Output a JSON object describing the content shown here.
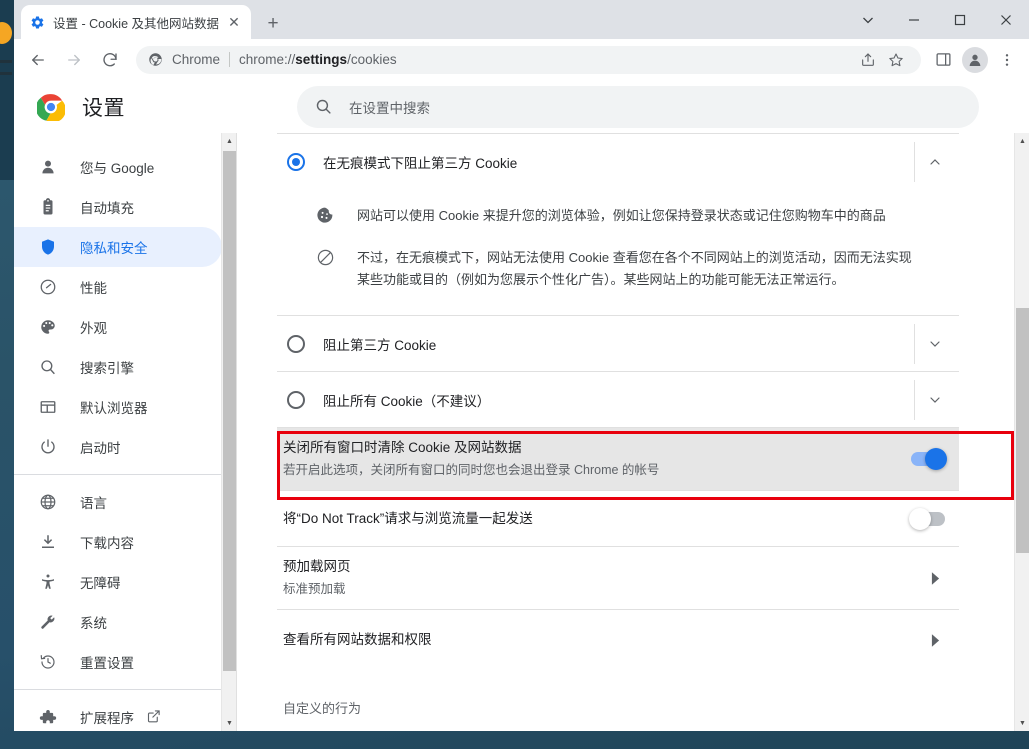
{
  "window": {
    "controls": {
      "tab_search_label": "tab-search",
      "minimize_label": "—",
      "maximize_label": "▢",
      "close_label": "✕"
    }
  },
  "tab": {
    "title": "设置 - Cookie 及其他网站数据",
    "close_label": "✕",
    "favicon_name": "settings-gear-icon",
    "newtab_label": "+"
  },
  "toolbar": {
    "back_label": "←",
    "forward_label": "→",
    "reload_label": "⟳",
    "omnibox": {
      "scheme_label": "Chrome",
      "url_prefix": "chrome://",
      "url_bold": "settings",
      "url_suffix": "/cookies"
    }
  },
  "settings_header": {
    "title": "设置",
    "search_placeholder": "在设置中搜索"
  },
  "sidebar": {
    "groups": [
      {
        "items": [
          {
            "label": "您与 Google",
            "icon": "person-icon",
            "selected": false
          },
          {
            "label": "自动填充",
            "icon": "clipboard-icon",
            "selected": false
          },
          {
            "label": "隐私和安全",
            "icon": "shield-icon",
            "selected": true
          },
          {
            "label": "性能",
            "icon": "speedometer-icon",
            "selected": false
          },
          {
            "label": "外观",
            "icon": "palette-icon",
            "selected": false
          },
          {
            "label": "搜索引擎",
            "icon": "search-icon",
            "selected": false
          },
          {
            "label": "默认浏览器",
            "icon": "browser-window-icon",
            "selected": false
          },
          {
            "label": "启动时",
            "icon": "power-icon",
            "selected": false
          }
        ]
      },
      {
        "items": [
          {
            "label": "语言",
            "icon": "globe-icon",
            "selected": false
          },
          {
            "label": "下载内容",
            "icon": "download-icon",
            "selected": false
          },
          {
            "label": "无障碍",
            "icon": "accessibility-icon",
            "selected": false
          },
          {
            "label": "系统",
            "icon": "wrench-icon",
            "selected": false
          },
          {
            "label": "重置设置",
            "icon": "history-restore-icon",
            "selected": false
          }
        ]
      },
      {
        "items": [
          {
            "label": "扩展程序",
            "icon": "puzzle-icon",
            "selected": false,
            "external": true
          }
        ]
      }
    ]
  },
  "main": {
    "expanded_option": {
      "label": "在无痕模式下阻止第三方 Cookie",
      "checked": true,
      "chevron": "up",
      "bullets": [
        {
          "icon": "cookie-icon",
          "text": "网站可以使用 Cookie 来提升您的浏览体验，例如让您保持登录状态或记住您购物车中的商品"
        },
        {
          "icon": "blocked-icon",
          "text": "不过，在无痕模式下，网站无法使用 Cookie 查看您在各个不同网站上的浏览活动，因而无法实现某些功能或目的（例如为您展示个性化广告）。某些网站上的功能可能无法正常运行。"
        }
      ]
    },
    "options": [
      {
        "label": "阻止第三方 Cookie",
        "checked": false,
        "chevron": "down"
      },
      {
        "label": "阻止所有 Cookie（不建议）",
        "checked": false,
        "chevron": "down"
      }
    ],
    "clear_on_close": {
      "title": "关闭所有窗口时清除 Cookie 及网站数据",
      "subtitle": "若开启此选项，关闭所有窗口的同时您也会退出登录 Chrome 的帐号",
      "toggle_state": "on",
      "highlighted": true,
      "highlight_color": "#e8000d"
    },
    "do_not_track": {
      "title": "将“Do Not Track”请求与浏览流量一起发送",
      "toggle_state": "off"
    },
    "preload": {
      "title": "预加载网页",
      "subtitle": "标准预加载",
      "arrow": "▶"
    },
    "site_data": {
      "title": "查看所有网站数据和权限",
      "arrow": "▶"
    },
    "custom_behavior_label": "自定义的行为"
  },
  "colors": {
    "accent": "#1a73e8",
    "selected_bg": "#e8f0fe",
    "highlight_red": "#e8000d",
    "toggle_on_track": "#8ab4f8",
    "toggle_off_track": "#bdc1c6",
    "row_highlight_bg": "#e6e6e6"
  }
}
